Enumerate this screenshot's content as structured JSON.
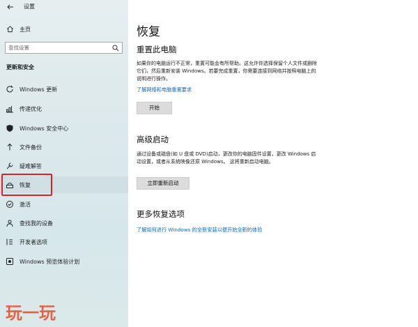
{
  "window": {
    "title": "设置"
  },
  "sidebar": {
    "home_label": "主页",
    "search_placeholder": "查找设置",
    "section_title": "更新和安全",
    "items": [
      {
        "label": "Windows 更新",
        "icon": "refresh-icon"
      },
      {
        "label": "传递优化",
        "icon": "delivery-optimization-icon"
      },
      {
        "label": "Windows 安全中心",
        "icon": "shield-icon"
      },
      {
        "label": "文件备份",
        "icon": "backup-arrow-icon"
      },
      {
        "label": "疑难解答",
        "icon": "wrench-icon"
      },
      {
        "label": "恢复",
        "icon": "recovery-icon",
        "selected": true
      },
      {
        "label": "激活",
        "icon": "check-circle-icon"
      },
      {
        "label": "查找我的设备",
        "icon": "person-locate-icon"
      },
      {
        "label": "开发者选项",
        "icon": "developer-tools-icon"
      },
      {
        "label": "Windows 预览体验计划",
        "icon": "insider-icon"
      }
    ],
    "watermark_text": "玩一玩"
  },
  "main": {
    "title": "恢复",
    "reset": {
      "heading": "重置此电脑",
      "description": "如果你的电脑运行不正常，重置可能会有所帮助。这允许你选择保留个人文件或删除它们，然后重新安装 Windows。若要完成重置，你需要连接到网络并按照电脑上的说明进行操作。",
      "link": "了解网络和电脑重置要求",
      "button": "开始"
    },
    "advanced": {
      "heading": "高级启动",
      "description": "通过设备或磁盘(如 U 盘或 DVD)启动，更改你的电脑固件设置，更改 Windows 启动设置，或者从系统映像还原 Windows。 这将重新启动电脑。",
      "button": "立即重新启动"
    },
    "more": {
      "heading": "更多恢复选项",
      "link": "了解如何进行 Windows 的全新安装以便开始全新的体验"
    }
  },
  "colors": {
    "accent_link": "#0a6cc8",
    "highlight_border": "#e02020",
    "sidebar_bg": "#dde9ec",
    "button_bg": "#dcdcdc"
  }
}
